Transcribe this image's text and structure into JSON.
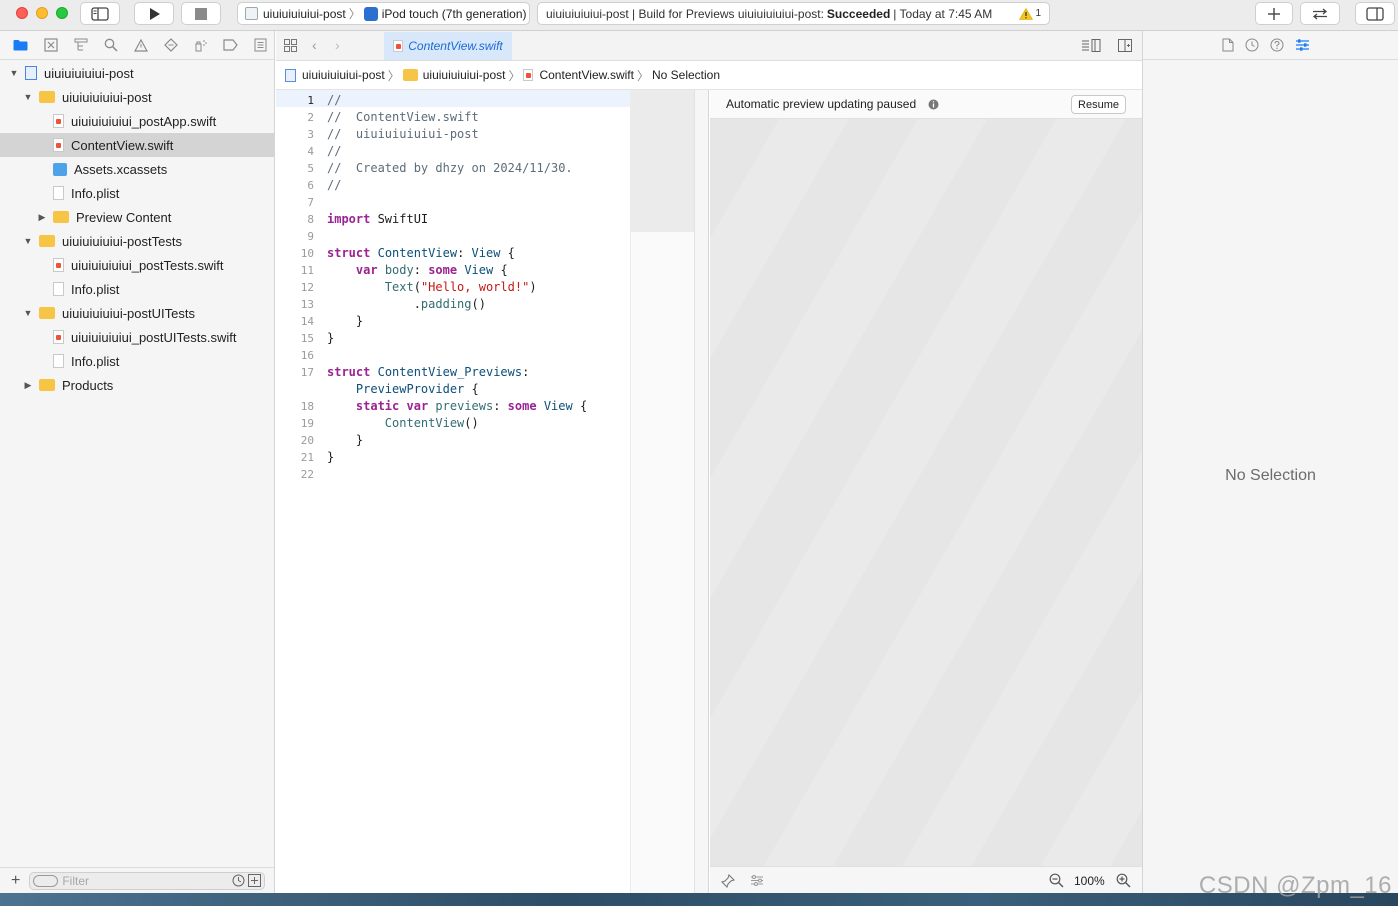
{
  "toolbar": {
    "scheme": "uiuiuiuiuiui-post",
    "destination": "iPod touch (7th generation)",
    "status_prefix": "uiuiuiuiuiui-post | Build for Previews uiuiuiuiuiui-post:",
    "status_result": "Succeeded",
    "status_time": "| Today at 7:45 AM",
    "warning_count": "1"
  },
  "navigator": {
    "tabs": [
      "folder-icon",
      "x-square-icon",
      "hierarchy-icon",
      "search-icon",
      "warning-triangle-icon",
      "diamond-icon",
      "spray-icon",
      "tag-icon",
      "list-icon"
    ],
    "items": [
      {
        "label": "uiuiuiuiuiui-post",
        "depth": 0,
        "expanded": true,
        "icon": "project"
      },
      {
        "label": "uiuiuiuiuiui-post",
        "depth": 1,
        "expanded": true,
        "icon": "folder"
      },
      {
        "label": "uiuiuiuiuiui_postApp.swift",
        "depth": 2,
        "icon": "swift"
      },
      {
        "label": "ContentView.swift",
        "depth": 2,
        "icon": "swift",
        "selected": true
      },
      {
        "label": "Assets.xcassets",
        "depth": 2,
        "icon": "assets"
      },
      {
        "label": "Info.plist",
        "depth": 2,
        "icon": "plist"
      },
      {
        "label": "Preview Content",
        "depth": 2,
        "expanded": false,
        "icon": "folder"
      },
      {
        "label": "uiuiuiuiuiui-postTests",
        "depth": 1,
        "expanded": true,
        "icon": "folder"
      },
      {
        "label": "uiuiuiuiuiui_postTests.swift",
        "depth": 2,
        "icon": "swift"
      },
      {
        "label": "Info.plist",
        "depth": 2,
        "icon": "plist"
      },
      {
        "label": "uiuiuiuiuiui-postUITests",
        "depth": 1,
        "expanded": true,
        "icon": "folder"
      },
      {
        "label": "uiuiuiuiuiui_postUITests.swift",
        "depth": 2,
        "icon": "swift"
      },
      {
        "label": "Info.plist",
        "depth": 2,
        "icon": "plist"
      },
      {
        "label": "Products",
        "depth": 1,
        "expanded": false,
        "icon": "folder"
      }
    ],
    "filter_placeholder": "Filter"
  },
  "editor": {
    "tab_label": "ContentView.swift",
    "jumpbar": [
      "uiuiuiuiuiui-post",
      "uiuiuiuiuiui-post",
      "ContentView.swift",
      "No Selection"
    ],
    "lines": [
      {
        "n": "1",
        "tokens": [
          [
            "c",
            "//"
          ]
        ]
      },
      {
        "n": "2",
        "tokens": [
          [
            "c",
            "//  ContentView.swift"
          ]
        ]
      },
      {
        "n": "3",
        "tokens": [
          [
            "c",
            "//  uiuiuiuiuiui-post"
          ]
        ]
      },
      {
        "n": "4",
        "tokens": [
          [
            "c",
            "//"
          ]
        ]
      },
      {
        "n": "5",
        "tokens": [
          [
            "c",
            "//  Created by dhzy on 2024/11/30."
          ]
        ]
      },
      {
        "n": "6",
        "tokens": [
          [
            "c",
            "//"
          ]
        ]
      },
      {
        "n": "7",
        "tokens": []
      },
      {
        "n": "8",
        "tokens": [
          [
            "k",
            "import"
          ],
          [
            "p",
            " SwiftUI"
          ]
        ]
      },
      {
        "n": "9",
        "tokens": []
      },
      {
        "n": "10",
        "tokens": [
          [
            "k",
            "struct"
          ],
          [
            "p",
            " "
          ],
          [
            "t",
            "ContentView"
          ],
          [
            "p",
            ": "
          ],
          [
            "t",
            "View"
          ],
          [
            "p",
            " {"
          ]
        ]
      },
      {
        "n": "11",
        "tokens": [
          [
            "p",
            "    "
          ],
          [
            "k",
            "var"
          ],
          [
            "p",
            " "
          ],
          [
            "f",
            "body"
          ],
          [
            "p",
            ": "
          ],
          [
            "k",
            "some"
          ],
          [
            "p",
            " "
          ],
          [
            "t",
            "View"
          ],
          [
            "p",
            " {"
          ]
        ]
      },
      {
        "n": "12",
        "tokens": [
          [
            "p",
            "        "
          ],
          [
            "f",
            "Text"
          ],
          [
            "p",
            "("
          ],
          [
            "s",
            "\"Hello, world!\""
          ],
          [
            "p",
            ")"
          ]
        ]
      },
      {
        "n": "13",
        "tokens": [
          [
            "p",
            "            ."
          ],
          [
            "f",
            "padding"
          ],
          [
            "p",
            "()"
          ]
        ]
      },
      {
        "n": "14",
        "tokens": [
          [
            "p",
            "    }"
          ]
        ]
      },
      {
        "n": "15",
        "tokens": [
          [
            "p",
            "}"
          ]
        ]
      },
      {
        "n": "16",
        "tokens": []
      },
      {
        "n": "17",
        "tokens": [
          [
            "k",
            "struct"
          ],
          [
            "p",
            " "
          ],
          [
            "t",
            "ContentView_Previews"
          ],
          [
            "p",
            ":"
          ]
        ]
      },
      {
        "n": "",
        "tokens": [
          [
            "p",
            "    "
          ],
          [
            "t",
            "PreviewProvider"
          ],
          [
            "p",
            " {"
          ]
        ]
      },
      {
        "n": "18",
        "tokens": [
          [
            "p",
            "    "
          ],
          [
            "k",
            "static"
          ],
          [
            "p",
            " "
          ],
          [
            "k",
            "var"
          ],
          [
            "p",
            " "
          ],
          [
            "f",
            "previews"
          ],
          [
            "p",
            ": "
          ],
          [
            "k",
            "some"
          ],
          [
            "p",
            " "
          ],
          [
            "t",
            "View"
          ],
          [
            "p",
            " {"
          ]
        ]
      },
      {
        "n": "19",
        "tokens": [
          [
            "p",
            "        "
          ],
          [
            "f",
            "ContentView"
          ],
          [
            "p",
            "()"
          ]
        ]
      },
      {
        "n": "20",
        "tokens": [
          [
            "p",
            "    }"
          ]
        ]
      },
      {
        "n": "21",
        "tokens": [
          [
            "p",
            "}"
          ]
        ]
      },
      {
        "n": "22",
        "tokens": []
      }
    ]
  },
  "canvas": {
    "banner": "Automatic preview updating paused",
    "resume_label": "Resume",
    "zoom": "100%"
  },
  "inspector": {
    "empty_text": "No Selection"
  },
  "watermark": "CSDN @Zpm_16",
  "colors": {
    "accent": "#1a7cf5",
    "comment": "#5d6c79",
    "keyword": "#9b2393",
    "type": "#0b4f79",
    "string": "#c41a16"
  }
}
